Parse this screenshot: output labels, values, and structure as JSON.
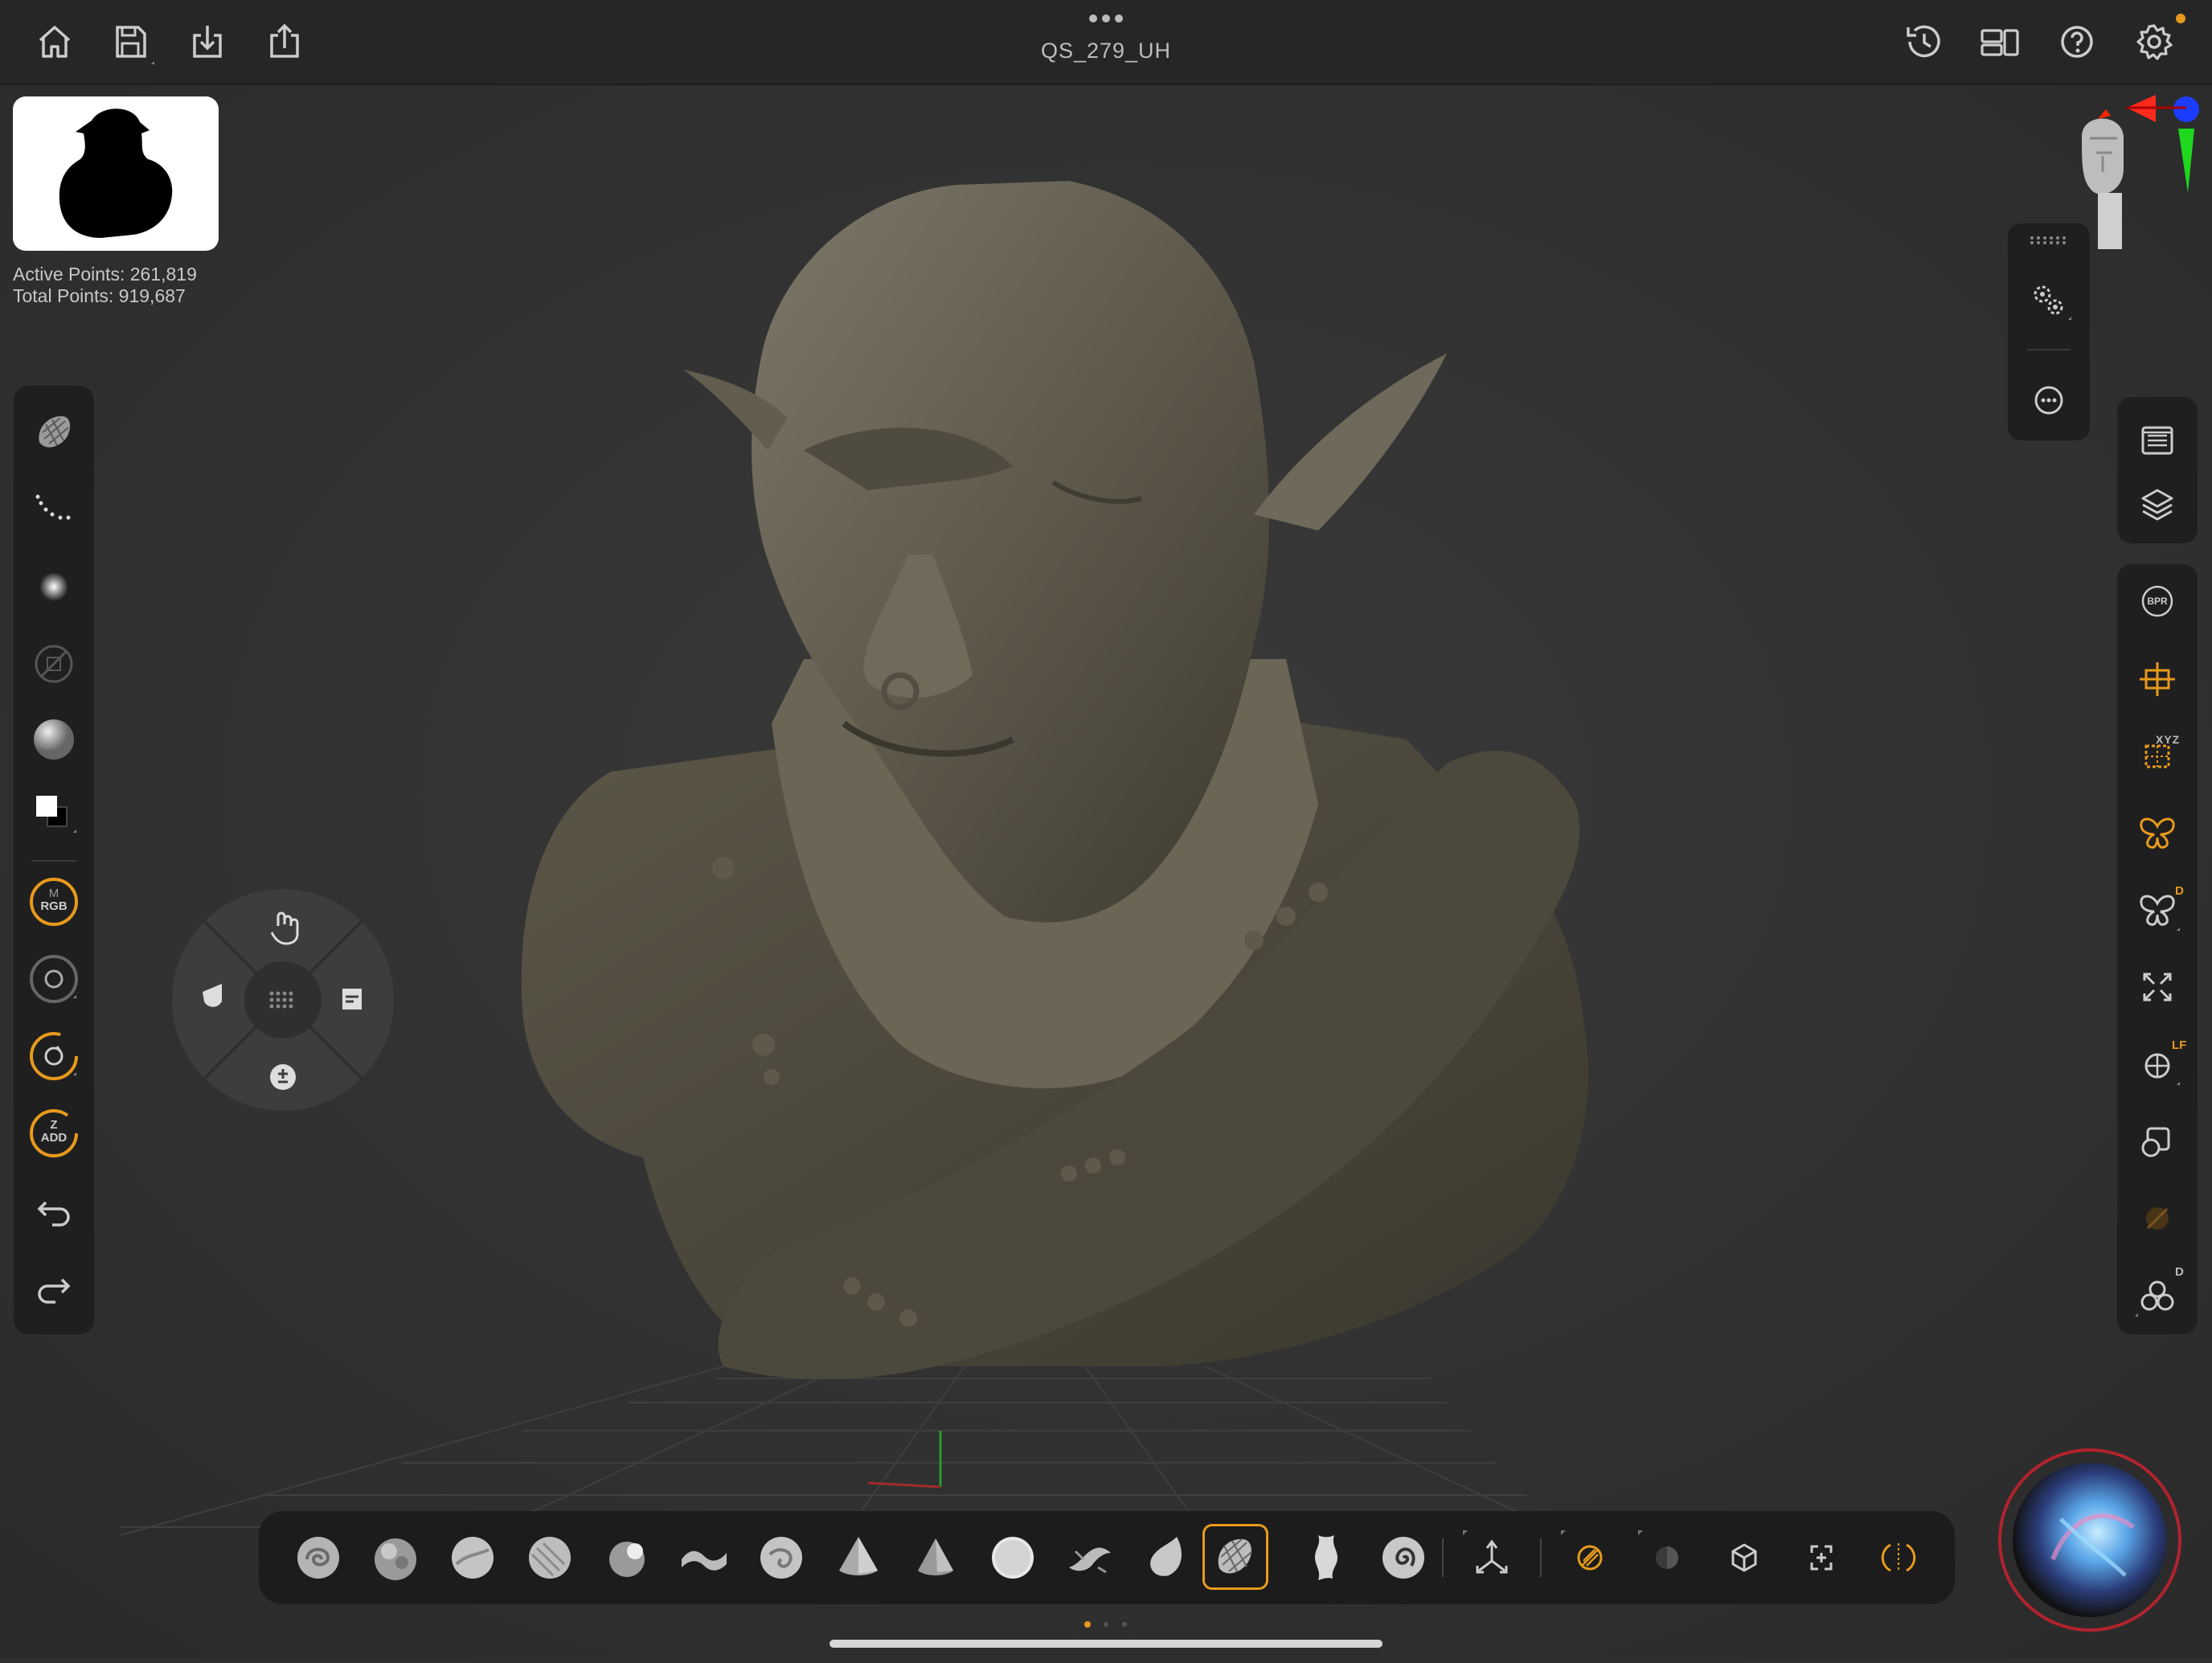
{
  "app": {
    "document_title": "QS_279_UH",
    "accent_color": "#e89a1c",
    "background_color": "#2f2f2f"
  },
  "topbar": {
    "left_icons": [
      "home-icon",
      "save-icon",
      "import-icon",
      "export-icon"
    ],
    "right_icons": [
      "history-icon",
      "layout-icon",
      "help-icon",
      "settings-icon"
    ]
  },
  "stats": {
    "active_points": "Active Points: 261,819",
    "total_points": "Total Points: 919,687"
  },
  "left_toolbar": {
    "items": [
      "brush-icon",
      "stroke-icon",
      "alpha-icon",
      "texture-icon",
      "material-icon",
      "color-swatch-icon"
    ],
    "rgb_ring_top": "M",
    "rgb_ring_label": "RGB",
    "zadd_ring_top": "Z",
    "zadd_ring_label": "ADD",
    "undo": "undo-icon",
    "redo": "redo-icon"
  },
  "right_toolbar": {
    "bpr_label": "BPR",
    "xyz_label": "XYZ",
    "d_label": "D",
    "lf_label": "LF",
    "d2_label": "D"
  },
  "brush_bar": {
    "selected_index": 12,
    "brushes": [
      "clay-buildup",
      "inflate",
      "standard",
      "move",
      "dam-standard",
      "smooth",
      "snakehook",
      "trim-dynamic",
      "hpolish",
      "sphere",
      "curve",
      "pinch",
      "mesh-brush",
      "selection",
      "spiral"
    ]
  }
}
